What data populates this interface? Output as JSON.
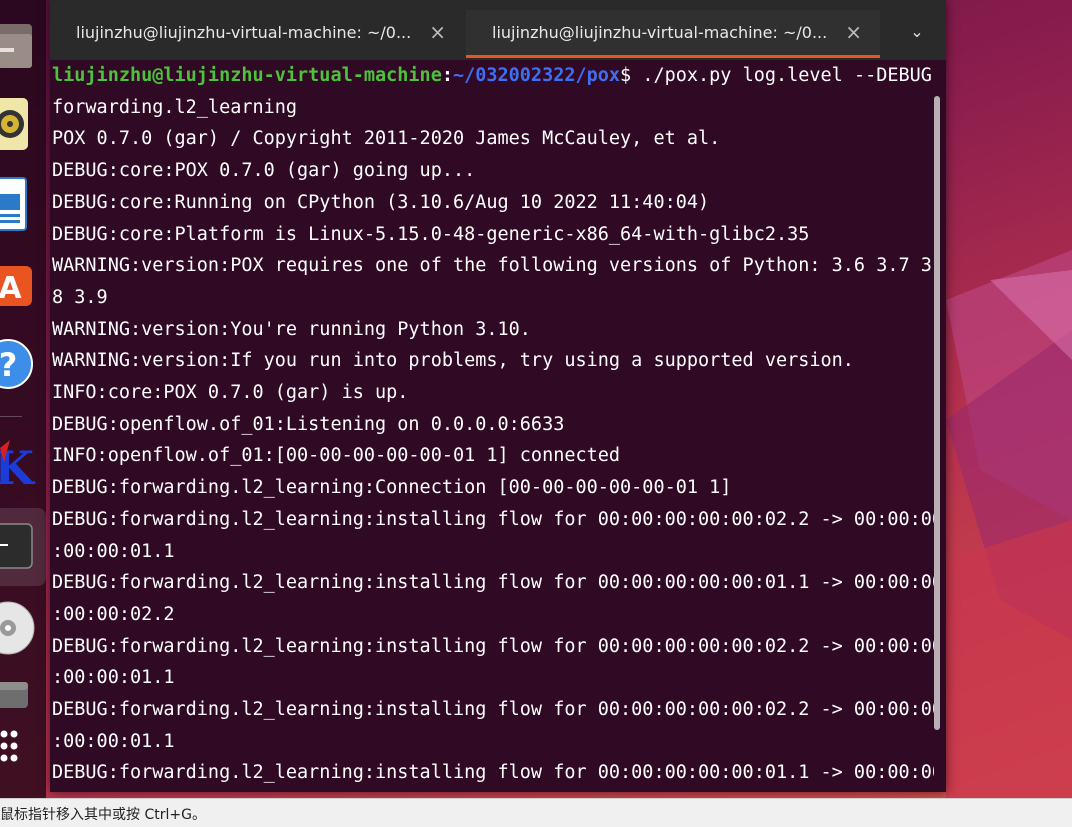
{
  "tabs": [
    {
      "title": "liujinzhu@liujinzhu-virtual-machine: ~/0...",
      "close": "×",
      "active": false
    },
    {
      "title": "liujinzhu@liujinzhu-virtual-machine: ~/0...",
      "close": "×",
      "active": true
    }
  ],
  "tab_menu": "⌄",
  "prompt": {
    "user_host": "liujinzhu@liujinzhu-virtual-machine",
    "separator": ":",
    "path": "~/032002322/pox",
    "symbol": "$ ",
    "command": "./pox.py log.level --DEBUG"
  },
  "lines": [
    "forwarding.l2_learning",
    "POX 0.7.0 (gar) / Copyright 2011-2020 James McCauley, et al.",
    "DEBUG:core:POX 0.7.0 (gar) going up...",
    "DEBUG:core:Running on CPython (3.10.6/Aug 10 2022 11:40:04)",
    "DEBUG:core:Platform is Linux-5.15.0-48-generic-x86_64-with-glibc2.35",
    "WARNING:version:POX requires one of the following versions of Python: 3.6 3.7 3.",
    "8 3.9",
    "WARNING:version:You're running Python 3.10.",
    "WARNING:version:If you run into problems, try using a supported version.",
    "INFO:core:POX 0.7.0 (gar) is up.",
    "DEBUG:openflow.of_01:Listening on 0.0.0.0:6633",
    "INFO:openflow.of_01:[00-00-00-00-00-01 1] connected",
    "DEBUG:forwarding.l2_learning:Connection [00-00-00-00-00-01 1]",
    "DEBUG:forwarding.l2_learning:installing flow for 00:00:00:00:00:02.2 -> 00:00:00",
    ":00:00:01.1",
    "DEBUG:forwarding.l2_learning:installing flow for 00:00:00:00:00:01.1 -> 00:00:00",
    ":00:00:02.2",
    "DEBUG:forwarding.l2_learning:installing flow for 00:00:00:00:00:02.2 -> 00:00:00",
    ":00:00:01.1",
    "DEBUG:forwarding.l2_learning:installing flow for 00:00:00:00:00:02.2 -> 00:00:00",
    ":00:00:01.1",
    "DEBUG:forwarding.l2_learning:installing flow for 00:00:00:00:00:01.1 -> 00:00:00"
  ],
  "dock": {
    "items": [
      "files-icon",
      "rhythmbox-icon",
      "writer-icon",
      "app-center-icon",
      "help-icon",
      "tk-app-icon",
      "terminal-icon",
      "disc-icon",
      "drive-icon",
      "show-apps-icon"
    ],
    "tk_label": "K",
    "help_label": "?",
    "app_center_label": "A"
  },
  "statusbar": {
    "text": "鼠标指针移入其中或按 Ctrl+G。"
  },
  "colors": {
    "terminal_bg": "#300a24",
    "prompt_user": "#4ec13d",
    "prompt_path": "#3f6ff0",
    "accent": "#e95420"
  }
}
